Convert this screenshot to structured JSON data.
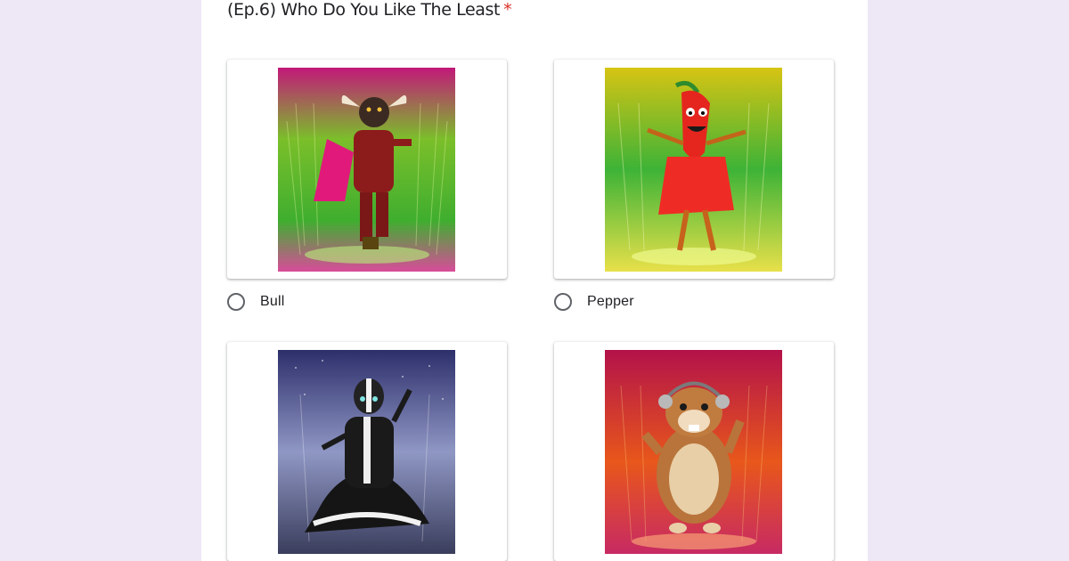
{
  "question": {
    "title": "(Ep.6) Who Do You Like The Least",
    "required_mark": "*"
  },
  "options": [
    {
      "label": "Bull",
      "image": "bull-costume-image",
      "selected": false
    },
    {
      "label": "Pepper",
      "image": "pepper-costume-image",
      "selected": false
    },
    {
      "label": "",
      "image": "skunk-costume-image",
      "selected": false
    },
    {
      "label": "",
      "image": "hamster-costume-image",
      "selected": false
    }
  ],
  "colors": {
    "background": "#ede7f6",
    "card": "#ffffff",
    "required": "#d93025",
    "radio_border": "#5f6368"
  }
}
